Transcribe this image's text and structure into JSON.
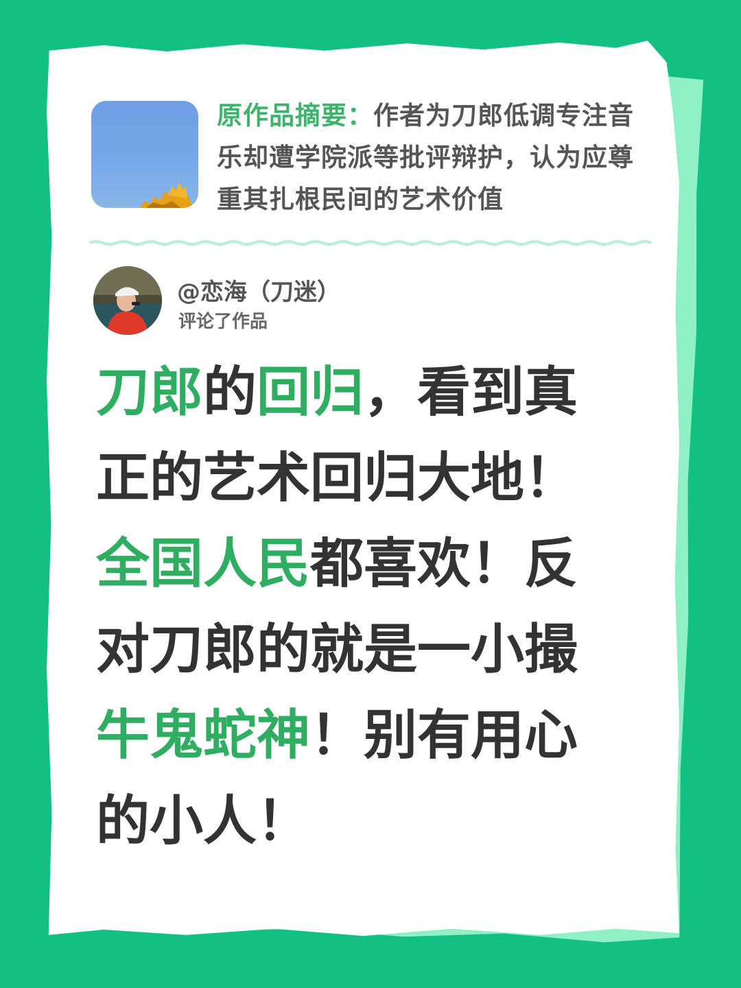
{
  "summary": {
    "label": "原作品摘要：",
    "text": "作者为刀郎低调专注音乐却遭学院派等批评辩护，认为应尊重其扎根民间的艺术价值"
  },
  "comment_author": {
    "username": "@恋海（刀迷）",
    "action": "评论了作品"
  },
  "comment": {
    "lines": [
      [
        {
          "t": "刀郎",
          "hl": true
        },
        {
          "t": "的",
          "hl": false
        },
        {
          "t": "回归",
          "hl": true
        },
        {
          "t": "，看到真",
          "hl": false
        }
      ],
      [
        {
          "t": "正的艺术回归大地！",
          "hl": false
        }
      ],
      [
        {
          "t": "全国人民",
          "hl": true
        },
        {
          "t": "都喜欢！反",
          "hl": false
        }
      ],
      [
        {
          "t": "对刀郎的就是一小撮",
          "hl": false
        }
      ],
      [
        {
          "t": "牛鬼蛇神",
          "hl": true
        },
        {
          "t": "！别有用心",
          "hl": false
        }
      ],
      [
        {
          "t": "的小人！",
          "hl": false
        }
      ]
    ]
  },
  "colors": {
    "background": "#13c083",
    "highlight": "#2fad60",
    "text": "#333333"
  }
}
